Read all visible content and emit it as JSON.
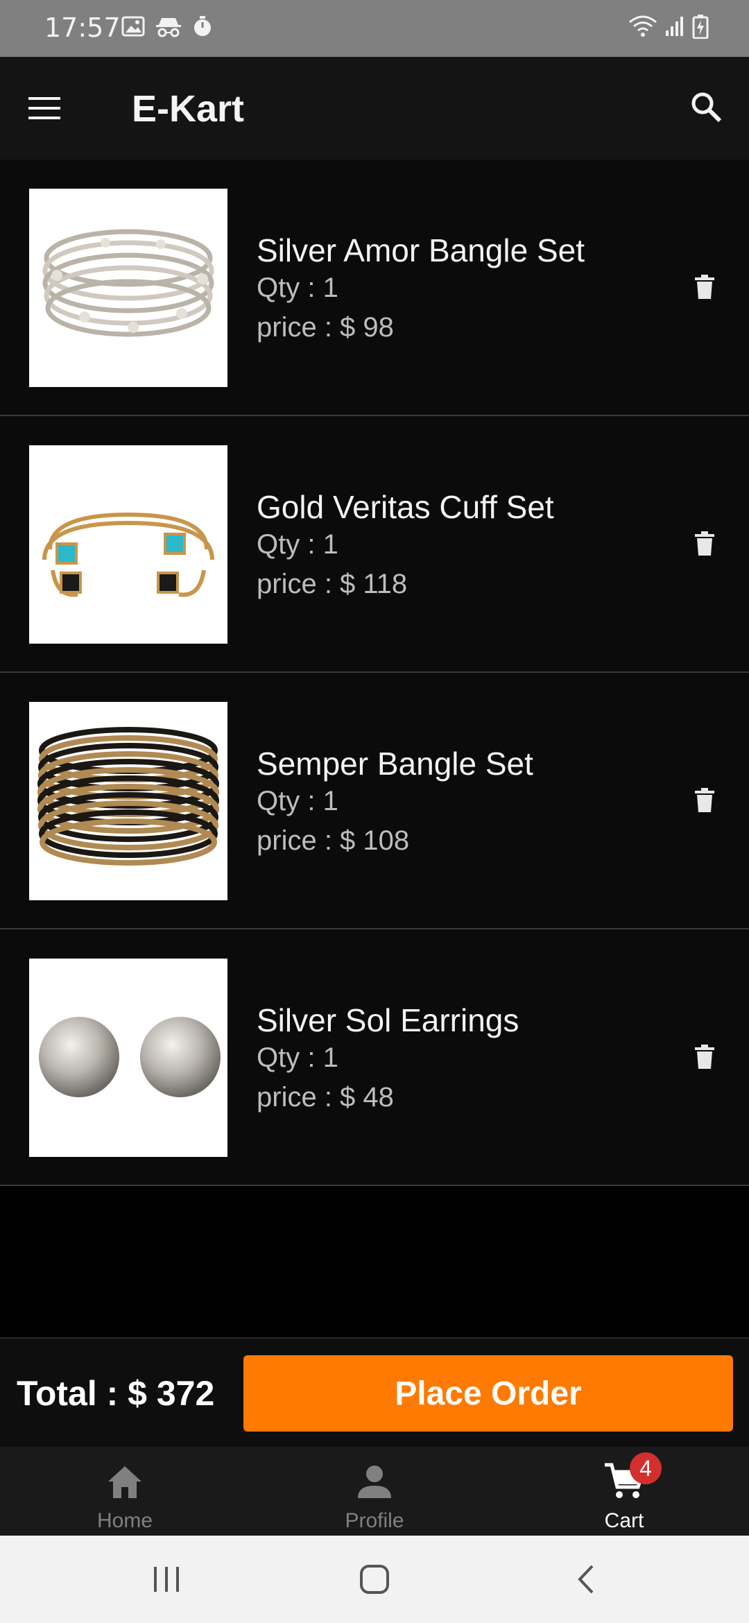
{
  "status_bar": {
    "time": "17:57",
    "left_icons": [
      "image-icon",
      "incognito-icon",
      "timer-icon"
    ],
    "right_icons": [
      "wifi-icon",
      "signal-icon",
      "battery-charging-icon"
    ]
  },
  "app_bar": {
    "title": "E-Kart",
    "menu_icon": "hamburger-menu-icon",
    "search_icon": "search-icon"
  },
  "cart": {
    "items": [
      {
        "name": "Silver Amor Bangle Set",
        "qty": "Qty : 1",
        "price": "price : $ 98",
        "image": "silver-bangles"
      },
      {
        "name": "Gold Veritas Cuff Set",
        "qty": "Qty : 1",
        "price": "price : $ 118",
        "image": "gold-cuffs"
      },
      {
        "name": "Semper Bangle Set",
        "qty": "Qty : 1",
        "price": "price : $ 108",
        "image": "black-gold-bangles"
      },
      {
        "name": "Silver Sol Earrings",
        "qty": "Qty : 1",
        "price": "price : $ 48",
        "image": "silver-earrings"
      }
    ]
  },
  "order_bar": {
    "total": "Total : $ 372",
    "place_order_label": "Place Order",
    "accent_color": "#ff7a00"
  },
  "bottom_nav": {
    "items": [
      {
        "label": "Home",
        "icon": "home-icon",
        "active": false
      },
      {
        "label": "Profile",
        "icon": "profile-icon",
        "active": false
      },
      {
        "label": "Cart",
        "icon": "cart-icon",
        "active": true,
        "badge": "4"
      }
    ]
  },
  "system_nav": {
    "buttons": [
      "recent-apps-icon",
      "home-button-icon",
      "back-icon"
    ]
  }
}
